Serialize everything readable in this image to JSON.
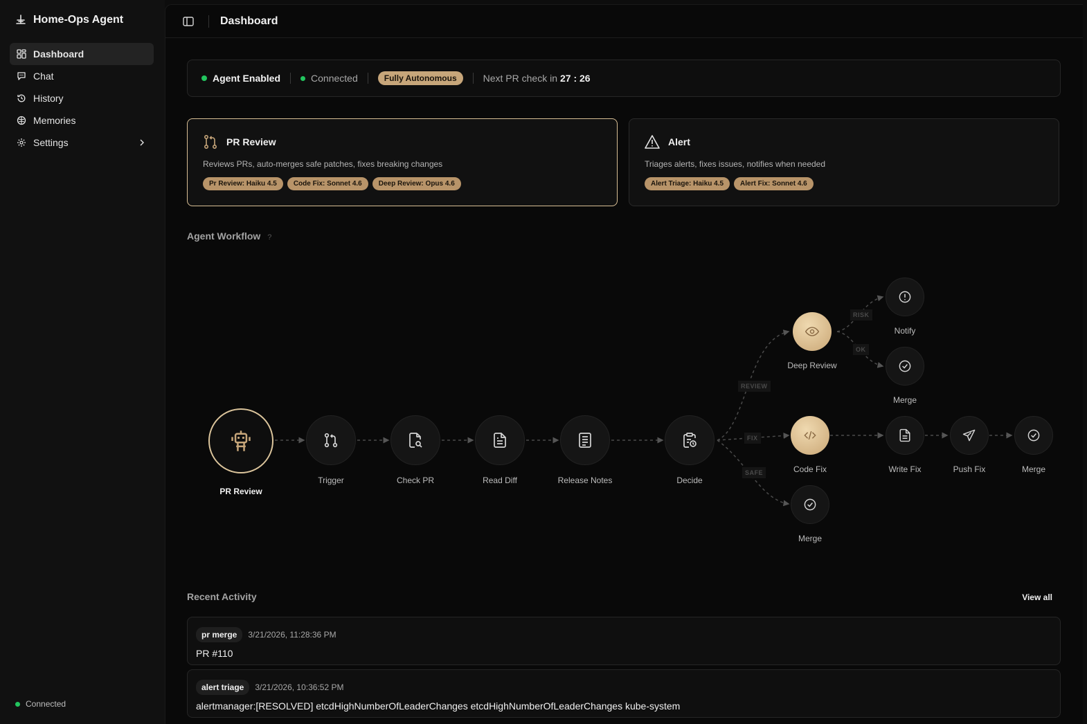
{
  "app": {
    "name": "Home-Ops Agent"
  },
  "sidebar": {
    "items": [
      {
        "label": "Dashboard",
        "icon": "dashboard-grid-icon",
        "active": true
      },
      {
        "label": "Chat",
        "icon": "chat-bubble-icon"
      },
      {
        "label": "History",
        "icon": "history-clock-icon"
      },
      {
        "label": "Memories",
        "icon": "brain-icon"
      },
      {
        "label": "Settings",
        "icon": "gear-icon",
        "has_submenu": true
      }
    ],
    "status": "Connected"
  },
  "header": {
    "title": "Dashboard"
  },
  "statusbar": {
    "agent": "Agent Enabled",
    "connection": "Connected",
    "mode": "Fully Autonomous",
    "next_check_label": "Next PR check in",
    "next_check_value": "27 : 26"
  },
  "cards": [
    {
      "title": "PR Review",
      "description": "Reviews PRs, auto-merges safe patches, fixes breaking changes",
      "models": [
        "Pr Review: Haiku 4.5",
        "Code Fix: Sonnet 4.6",
        "Deep Review: Opus 4.6"
      ],
      "selected": true,
      "icon": "git-pull-request-icon"
    },
    {
      "title": "Alert",
      "description": "Triages alerts, fixes issues, notifies when needed",
      "models": [
        "Alert Triage: Haiku 4.5",
        "Alert Fix: Sonnet 4.6"
      ],
      "selected": false,
      "icon": "warning-triangle-icon"
    }
  ],
  "workflow": {
    "title": "Agent Workflow",
    "help": "?",
    "nodes": {
      "start": "PR Review",
      "trigger": "Trigger",
      "check_pr": "Check PR",
      "read_diff": "Read Diff",
      "release_notes": "Release Notes",
      "decide": "Decide",
      "deep_review": "Deep Review",
      "notify": "Notify",
      "merge_ok": "Merge",
      "code_fix": "Code Fix",
      "write_fix": "Write Fix",
      "push_fix": "Push Fix",
      "merge_fix": "Merge",
      "merge_safe": "Merge"
    },
    "edges": {
      "review": "REVIEW",
      "fix": "FIX",
      "safe": "SAFE",
      "risk": "RISK",
      "ok": "OK"
    }
  },
  "activity": {
    "title": "Recent Activity",
    "view_all": "View all",
    "items": [
      {
        "type": "pr merge",
        "time": "3/21/2026, 11:28:36 PM",
        "text": "PR #110"
      },
      {
        "type": "alert triage",
        "time": "3/21/2026, 10:36:52 PM",
        "text": "alertmanager:[RESOLVED] etcdHighNumberOfLeaderChanges etcdHighNumberOfLeaderChanges kube-system"
      }
    ]
  },
  "colors": {
    "accent_gold": "#c7a67a",
    "status_green": "#22c55e",
    "background": "#090909"
  }
}
